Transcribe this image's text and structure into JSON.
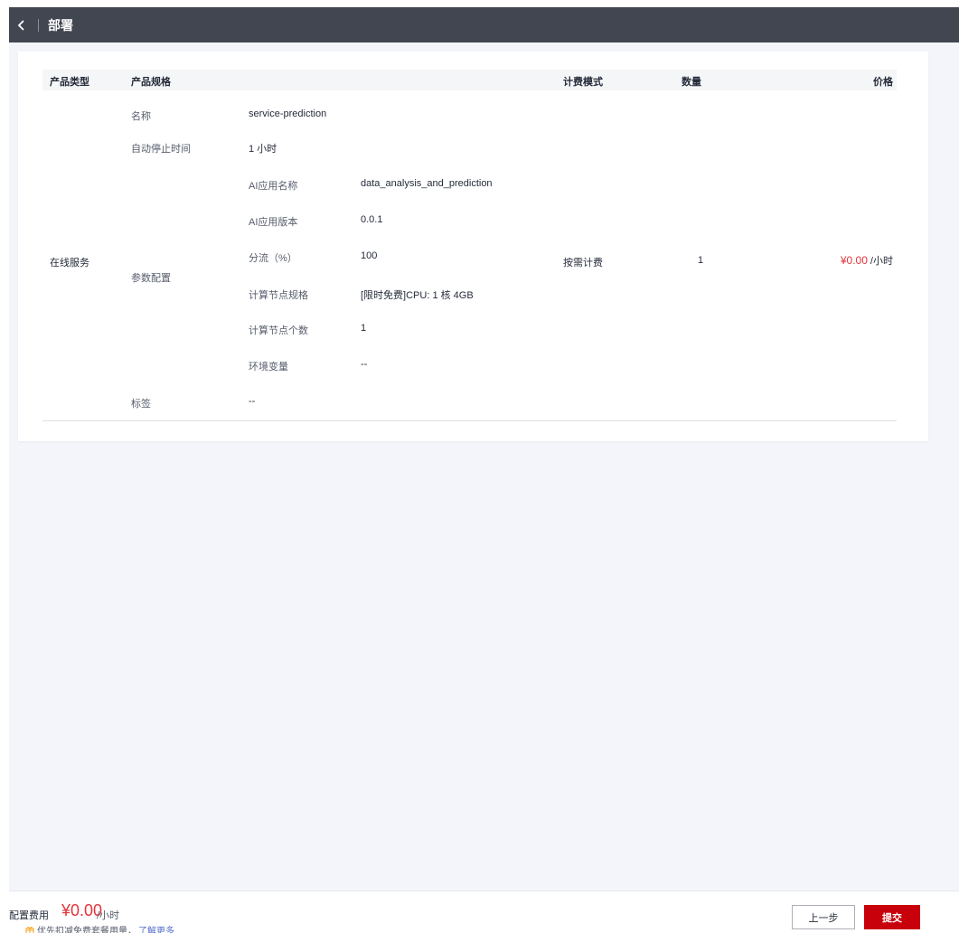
{
  "header": {
    "title": "部署"
  },
  "table": {
    "columns": {
      "type": "产品类型",
      "spec": "产品规格",
      "billing": "计费模式",
      "quantity": "数量",
      "price": "价格"
    },
    "row": {
      "product_type": "在线服务",
      "billing_mode": "按需计费",
      "quantity": "1",
      "price": "¥0.00",
      "price_unit": " /小时",
      "spec": {
        "name_label": "名称",
        "name_value": "service-prediction",
        "auto_stop_label": "自动停止时间",
        "auto_stop_value": "1 小时",
        "params_label": "参数配置",
        "params": [
          {
            "label": "AI应用名称",
            "value": "data_analysis_and_prediction"
          },
          {
            "label": "AI应用版本",
            "value": "0.0.1"
          },
          {
            "label": "分流（%）",
            "value": "100"
          },
          {
            "label": "计算节点规格",
            "value": "[限时免费]CPU: 1 核 4GB"
          },
          {
            "label": "计算节点个数",
            "value": "1"
          },
          {
            "label": "环境变量",
            "value": "--"
          }
        ],
        "tags_label": "标签",
        "tags_value": "--"
      }
    }
  },
  "footer": {
    "fee_label": "配置费用",
    "fee_amount": "¥0.00",
    "fee_unit": "/小时",
    "tip_text": "优先扣减免费套餐用量，",
    "tip_link": "了解更多",
    "prev_button": "上一步",
    "submit_button": "提交"
  },
  "colors": {
    "header_bg": "#414651",
    "accent_red": "#c7000b",
    "price_red": "#e5343b",
    "link_blue": "#526ecc"
  }
}
